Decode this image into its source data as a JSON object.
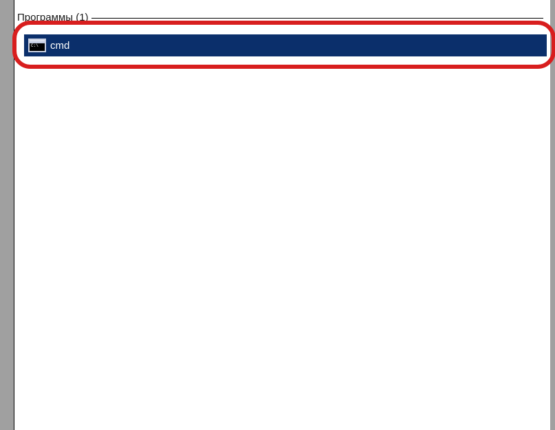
{
  "section": {
    "label": "Программы (1)"
  },
  "results": [
    {
      "label": "cmd",
      "icon": "cmd-icon"
    }
  ]
}
